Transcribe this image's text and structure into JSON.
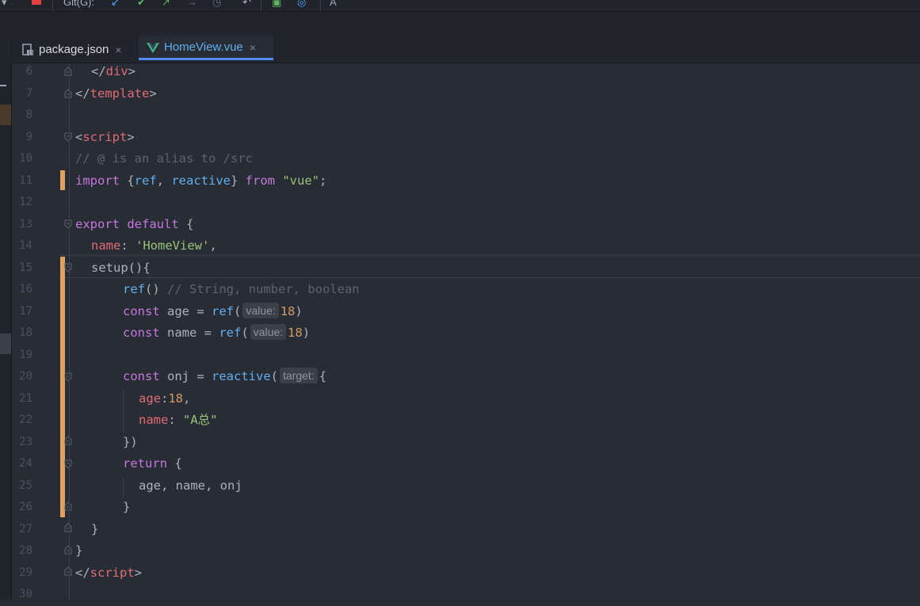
{
  "toolbar": {
    "git_label": "Git(G):"
  },
  "tabs": [
    {
      "label": "package.json",
      "close": "×",
      "active": false,
      "icon": "npm-json-file-icon"
    },
    {
      "label": "HomeView.vue",
      "close": "×",
      "active": true,
      "icon": "vue-file-icon"
    }
  ],
  "editor": {
    "lines": [
      {
        "n": "6"
      },
      {
        "n": "7"
      },
      {
        "n": "8"
      },
      {
        "n": "9"
      },
      {
        "n": "10"
      },
      {
        "n": "11"
      },
      {
        "n": "12"
      },
      {
        "n": "13"
      },
      {
        "n": "14"
      },
      {
        "n": "15"
      },
      {
        "n": "16"
      },
      {
        "n": "17"
      },
      {
        "n": "18"
      },
      {
        "n": "19"
      },
      {
        "n": "20"
      },
      {
        "n": "21"
      },
      {
        "n": "22"
      },
      {
        "n": "23"
      },
      {
        "n": "24"
      },
      {
        "n": "25"
      },
      {
        "n": "26"
      },
      {
        "n": "27"
      },
      {
        "n": "28"
      },
      {
        "n": "29"
      },
      {
        "n": "30"
      }
    ],
    "code": {
      "l6_open": "</",
      "l6_tag": "div",
      "l6_close": ">",
      "l7_open": "</",
      "l7_tag": "template",
      "l7_close": ">",
      "l9_open": "<",
      "l9_tag": "script",
      "l9_close": ">",
      "l10": "// @ is an alias to /src",
      "l11_kw": "import",
      "l11_b1": " {",
      "l11_ref": "ref",
      "l11_comma": ", ",
      "l11_reactive": "reactive",
      "l11_b2": "} ",
      "l11_from": "from",
      "l11_sp": " ",
      "l11_str": "\"vue\"",
      "l11_semi": ";",
      "l13_kw1": "export",
      "l13_kw2": "default",
      "l13_b": " {",
      "l14_prop": "name",
      "l14_colon": ": ",
      "l14_str": "'HomeView'",
      "l14_comma": ",",
      "l15": "setup(){",
      "l16_fn": "ref",
      "l16_p": "()",
      "l16_cmt": " // String, number, boolean",
      "l17_kw": "const",
      "l17_var": " age = ",
      "l17_fn": "ref",
      "l17_p": "(",
      "l17_hint": "value:",
      "l17_num": "18",
      "l17_end": ")",
      "l18_kw": "const",
      "l18_var": " name = ",
      "l18_fn": "ref",
      "l18_p": "(",
      "l18_hint": "value:",
      "l18_num": "18",
      "l18_end": ")",
      "l20_kw": "const",
      "l20_var": " onj = ",
      "l20_fn": "reactive",
      "l20_p": "(",
      "l20_hint": "target:",
      "l20_b": "{",
      "l21_prop": "age",
      "l21_colon": ":",
      "l21_num": "18",
      "l21_comma": ",",
      "l22_prop": "name",
      "l22_colon": ": ",
      "l22_str": "\"A总\"",
      "l23": "})",
      "l24_kw": "return",
      "l24_b": " {",
      "l25": "age, name, onj",
      "l26": "}",
      "l27": "}",
      "l28": "}",
      "l29_open": "</",
      "l29_tag": "script",
      "l29_close": ">"
    }
  },
  "colors": {
    "background": "#282c34",
    "tag": "#e06c75",
    "keyword": "#c678dd",
    "function": "#61afef",
    "string": "#98c379",
    "number": "#d19a66",
    "comment": "#5c6370",
    "changed_marker": "#e0a060"
  }
}
